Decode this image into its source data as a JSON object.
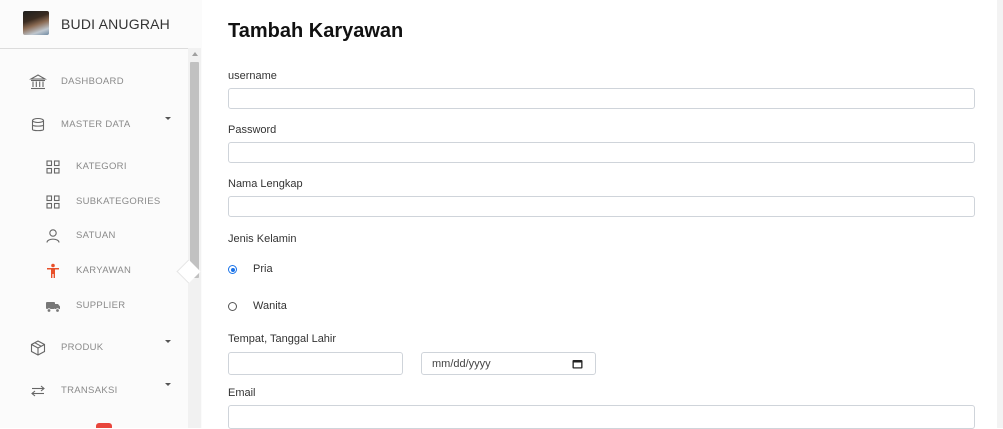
{
  "user": {
    "name": "BUDI ANUGRAH"
  },
  "nav": {
    "dashboard": "DASHBOARD",
    "master_data": "MASTER DATA",
    "kategori": "KATEGORI",
    "subkategories": "SUBKATEGORIES",
    "satuan": "SATUAN",
    "karyawan": "KARYAWAN",
    "supplier": "SUPPLIER",
    "produk": "PRODUK",
    "transaksi": "TRANSAKSI"
  },
  "icons": {
    "dashboard": "bank-icon",
    "master_data": "database-icon",
    "kategori": "grid-icon",
    "subkategories": "grid-icon",
    "satuan": "user-icon",
    "karyawan": "accessibility-icon",
    "supplier": "truck-icon",
    "produk": "box-icon",
    "transaksi": "arrows-icon"
  },
  "colors": {
    "accent": "#1a73e8",
    "karyawan_icon": "#e8502a"
  },
  "form": {
    "title": "Tambah Karyawan",
    "username_label": "username",
    "password_label": "Password",
    "fullname_label": "Nama Lengkap",
    "gender_label": "Jenis Kelamin",
    "gender_options": [
      "Pria",
      "Wanita"
    ],
    "gender_selected": "Pria",
    "birth_label": "Tempat, Tanggal Lahir",
    "date_placeholder": "mm/dd/yyyy",
    "email_label": "Email"
  }
}
